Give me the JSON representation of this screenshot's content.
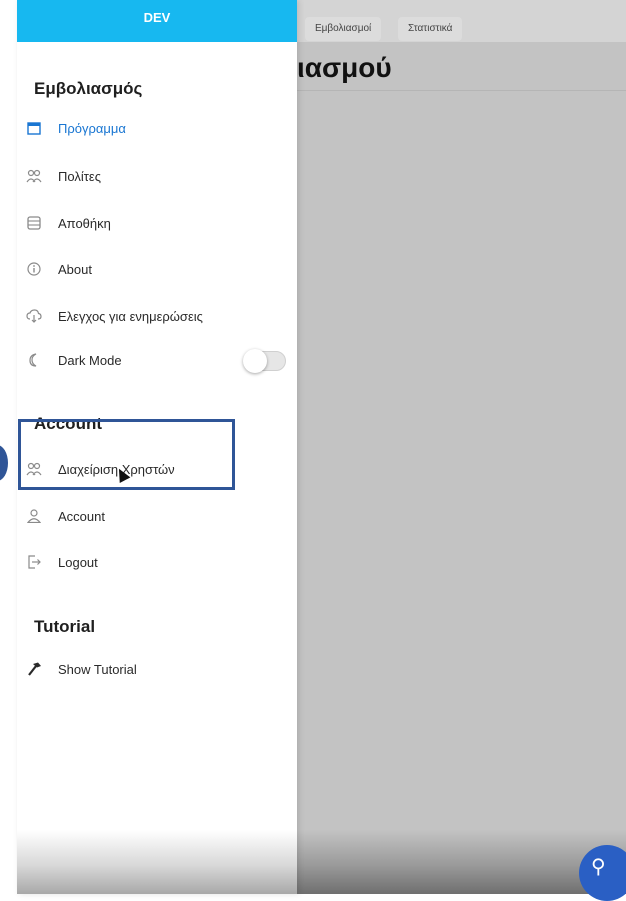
{
  "background": {
    "tabs": [
      "Εμβολιασμοί",
      "Στατιστικά"
    ],
    "title_fragment": "ιασμού"
  },
  "drawer": {
    "header": "DEV",
    "sections": [
      {
        "title": "Εμβολιασμός",
        "items": [
          {
            "label": "Πρόγραμμα",
            "icon": "calendar-icon",
            "active": true
          },
          {
            "label": "Πολίτες",
            "icon": "people-icon"
          },
          {
            "label": "Αποθήκη",
            "icon": "database-icon"
          },
          {
            "label": "About",
            "icon": "info-icon"
          },
          {
            "label": "Ελεγχος για ενημερώσεις",
            "icon": "cloud-download-icon"
          },
          {
            "label": "Dark Mode",
            "icon": "moon-icon",
            "toggle": false
          }
        ]
      },
      {
        "title": "Account",
        "items": [
          {
            "label": "Διαχείριση Χρηστών",
            "icon": "people-icon",
            "highlighted": true
          },
          {
            "label": "Account",
            "icon": "person-icon"
          },
          {
            "label": "Logout",
            "icon": "logout-icon"
          }
        ]
      },
      {
        "title": "Tutorial",
        "items": [
          {
            "label": "Show Tutorial",
            "icon": "hammer-icon"
          }
        ]
      }
    ]
  },
  "colors": {
    "header": "#17b8f0",
    "active": "#1976d2",
    "highlight": "#2f5597",
    "fab": "#2a5fc4"
  }
}
